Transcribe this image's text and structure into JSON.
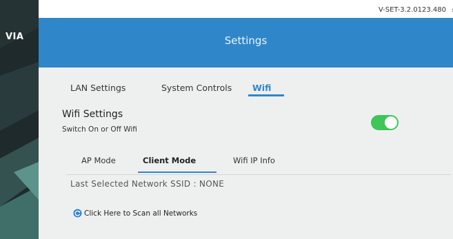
{
  "app": {
    "logo": "VIA",
    "version": "V-SET-3.2.0123.480",
    "close_glyph": "›"
  },
  "header": {
    "title": "Settings"
  },
  "tabs": [
    {
      "label": "LAN Settings",
      "active": false
    },
    {
      "label": "System Controls",
      "active": false
    },
    {
      "label": "Wifi",
      "active": true
    }
  ],
  "wifi": {
    "title": "Wifi Settings",
    "subtitle": "Switch On or Off Wifi",
    "enabled": true,
    "toggle_color": "#3fc558"
  },
  "subtabs": [
    {
      "label": "AP Mode",
      "active": false
    },
    {
      "label": "Client Mode",
      "active": true
    },
    {
      "label": "Wifi IP Info",
      "active": false
    }
  ],
  "client": {
    "last_ssid_label": "Last Selected Network SSID :",
    "last_ssid_value": "NONE",
    "scan_link": "Click Here to Scan all Networks",
    "scan_icon": "refresh-icon"
  },
  "colors": {
    "accent": "#2f86c9",
    "sidebar": "#1f2a2c",
    "content_bg": "#eef0f0"
  }
}
